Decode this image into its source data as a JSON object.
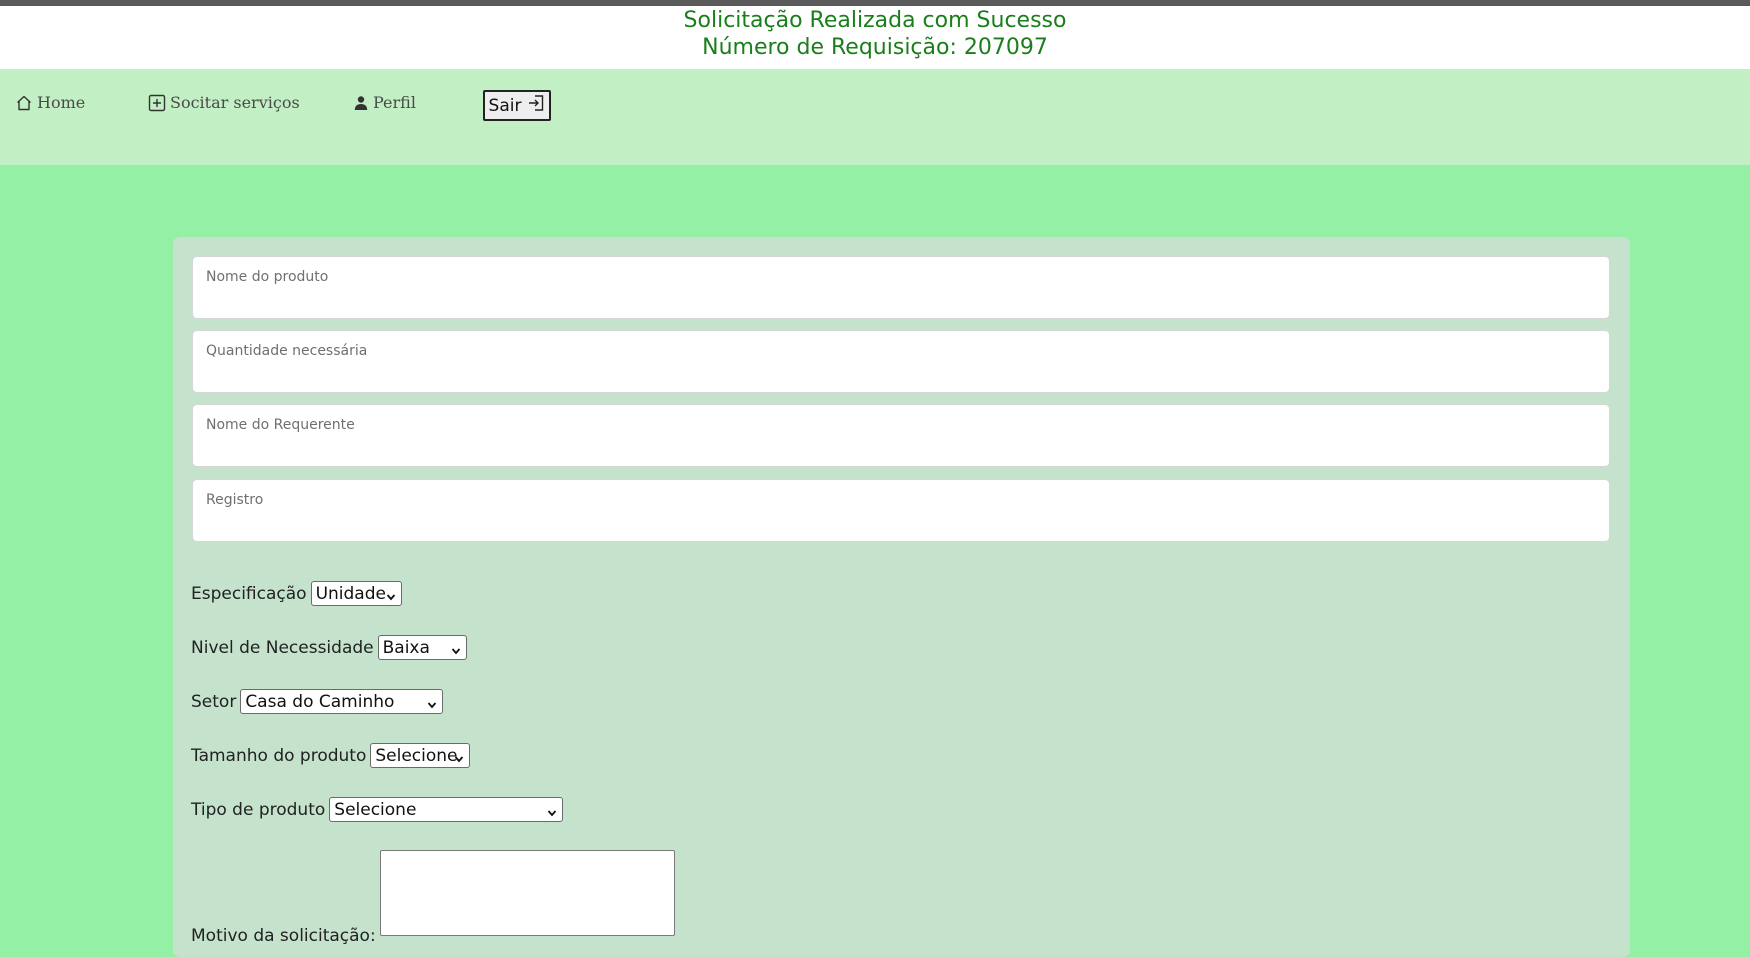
{
  "banner": {
    "line1": "Solicitação Realizada com Sucesso",
    "line2": "Número de Requisição: 207097"
  },
  "nav": {
    "home": "Home",
    "request": "Socitar serviços",
    "profile": "Perfil",
    "logout": "Sair"
  },
  "form": {
    "product_name_placeholder": "Nome do produto",
    "quantity_placeholder": "Quantidade necessária",
    "requester_placeholder": "Nome do Requerente",
    "registry_placeholder": "Registro",
    "specification": {
      "label": "Especificação",
      "value": "Unidade"
    },
    "need_level": {
      "label": "Nivel de Necessidade",
      "value": "Baixa"
    },
    "sector": {
      "label": "Setor",
      "value": "Casa do Caminho"
    },
    "size": {
      "label": "Tamanho do produto",
      "value": "Selecione"
    },
    "type": {
      "label": "Tipo de produto",
      "value": "Selecione"
    },
    "reason": {
      "label": "Motivo da solicitação:"
    }
  },
  "colors": {
    "page_bg": "#93f0a5",
    "nav_bg": "#c2f0c4",
    "panel_bg": "#c4e2cc",
    "banner_text": "#1a7f1a"
  }
}
